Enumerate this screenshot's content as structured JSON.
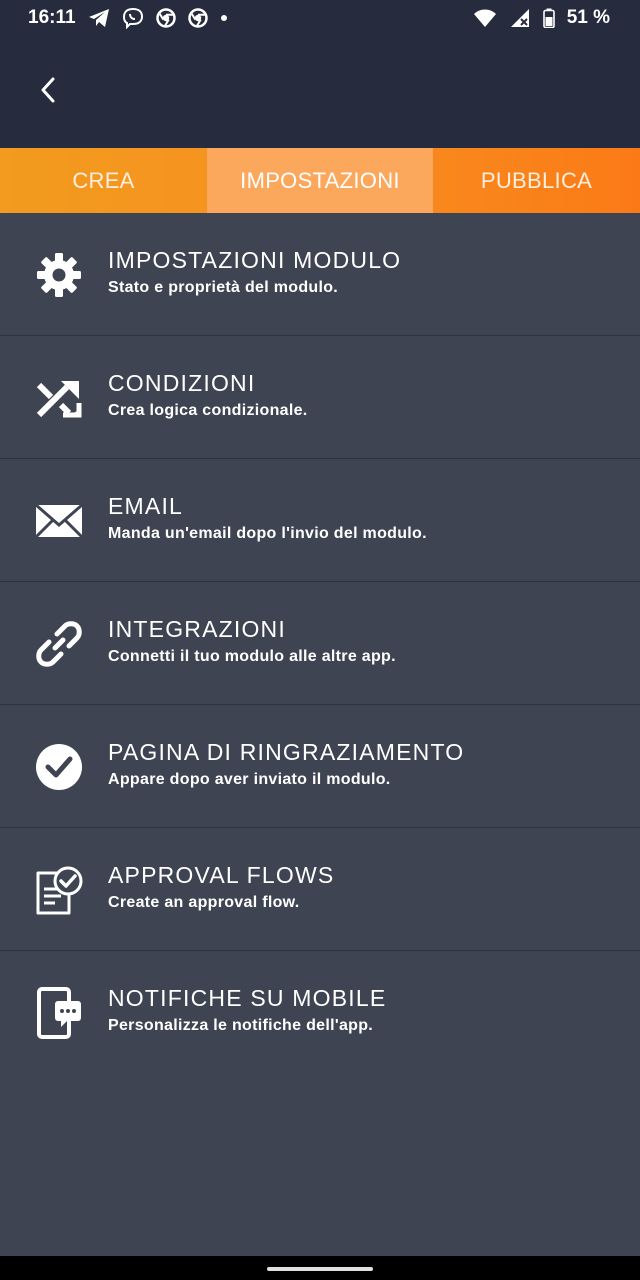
{
  "status_bar": {
    "time": "16:11",
    "battery": "51 %",
    "left_icons": [
      "telegram-icon",
      "viber-icon",
      "chrome-icon",
      "chrome-icon",
      "dot-icon"
    ],
    "right_icons": [
      "wifi-icon",
      "signal-icon",
      "battery-icon"
    ]
  },
  "header": {
    "back_icon": "chevron-left-icon"
  },
  "tabs": [
    {
      "label": "CREA",
      "active": false
    },
    {
      "label": "IMPOSTAZIONI",
      "active": true
    },
    {
      "label": "PUBBLICA",
      "active": false
    }
  ],
  "menu": {
    "items": [
      {
        "icon": "gear-icon",
        "title": "IMPOSTAZIONI MODULO",
        "subtitle": "Stato e proprietà del modulo."
      },
      {
        "icon": "shuffle-icon",
        "title": "CONDIZIONI",
        "subtitle": "Crea logica condizionale."
      },
      {
        "icon": "envelope-icon",
        "title": "EMAIL",
        "subtitle": "Manda un'email dopo l'invio del modulo."
      },
      {
        "icon": "link-icon",
        "title": "INTEGRAZIONI",
        "subtitle": "Connetti il tuo modulo alle altre app."
      },
      {
        "icon": "check-circle-icon",
        "title": "PAGINA DI RINGRAZIAMENTO",
        "subtitle": "Appare dopo aver inviato il modulo."
      },
      {
        "icon": "document-check-icon",
        "title": "APPROVAL FLOWS",
        "subtitle": "Create an approval flow."
      },
      {
        "icon": "mobile-notification-icon",
        "title": "NOTIFICHE SU MOBILE",
        "subtitle": "Personalizza le notifiche dell'app."
      }
    ]
  },
  "colors": {
    "background": "#3e4451",
    "header": "#262b3e",
    "tab_orange": "#f79020",
    "tab_active": "#fba75c"
  }
}
